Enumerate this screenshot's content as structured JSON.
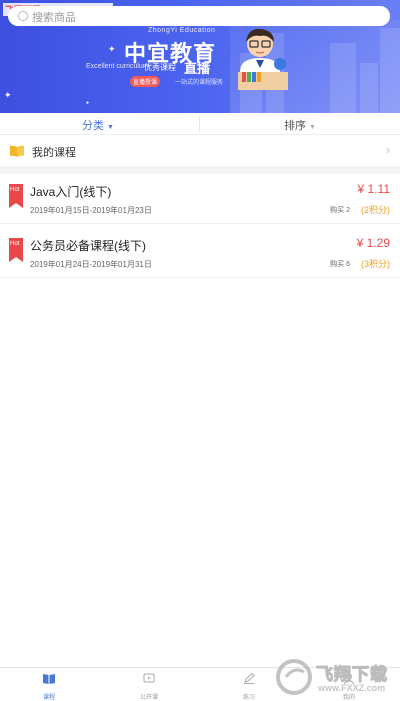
{
  "watermark": {
    "text": "飞翔下载 www.FXXZ.com"
  },
  "search": {
    "placeholder": "搜索商品"
  },
  "banner": {
    "subtitle": "ZhongYi Education",
    "title": "中宜教育",
    "english": "Excellent curriculum",
    "tagline": "优秀课程",
    "live": "直播",
    "badge": "直播授课",
    "tag2": "一站式的课程服务"
  },
  "filter": {
    "category": "分类",
    "sort": "排序"
  },
  "my_courses": {
    "label": "我的课程"
  },
  "courses": [
    {
      "badge": "Hot",
      "title": "Java入门(线下)",
      "dates": "2019年01月15日-2019年01月23日",
      "price": "¥ 1.11",
      "purchases": "购买 2",
      "points": "(2积分)"
    },
    {
      "badge": "Hot",
      "title": "公务员必备课程(线下)",
      "dates": "2019年01月24日-2019年01月31日",
      "price": "¥ 1.29",
      "purchases": "购买 6",
      "points": "(3积分)"
    }
  ],
  "tabs": [
    {
      "label": "课程",
      "icon": "book-icon",
      "active": true
    },
    {
      "label": "公开课",
      "icon": "video-icon",
      "active": false
    },
    {
      "label": "练习",
      "icon": "pencil-icon",
      "active": false
    },
    {
      "label": "我的",
      "icon": "user-icon",
      "active": false
    }
  ],
  "footer_watermark": {
    "cn": "飞翔下载",
    "url": "www.FXXZ.com"
  },
  "colors": {
    "accent": "#4a78d6",
    "price": "#e84848",
    "points": "#f0a020",
    "banner": "#4a63ef"
  }
}
